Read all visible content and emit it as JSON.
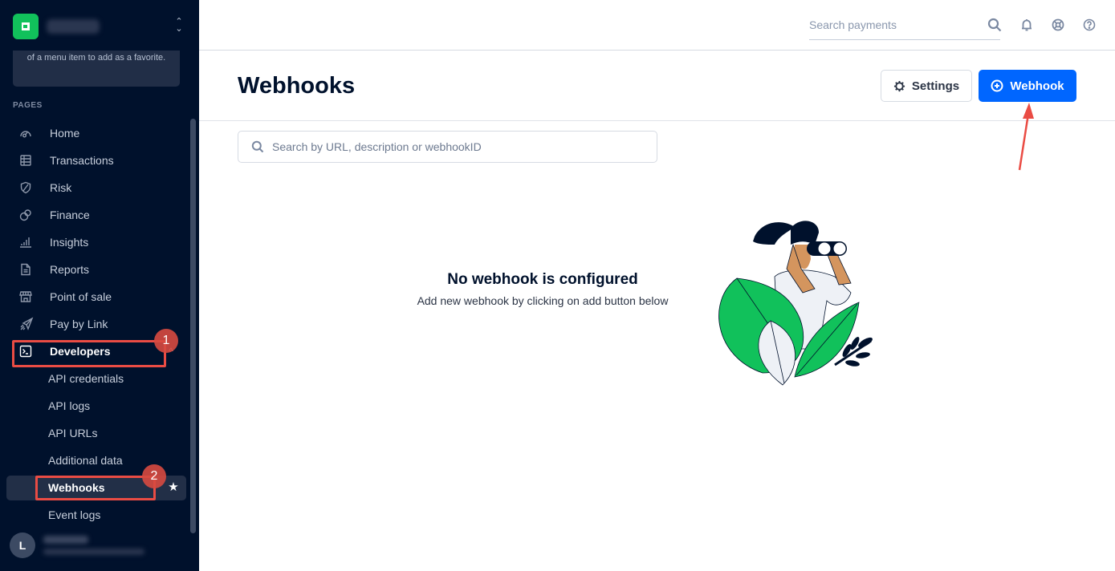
{
  "sidebar": {
    "favorite_hint": "of a menu item to add as a favorite.",
    "section_label": "PAGES",
    "nav": [
      {
        "label": "Home",
        "icon": "home-gauge-icon"
      },
      {
        "label": "Transactions",
        "icon": "table-icon"
      },
      {
        "label": "Risk",
        "icon": "shield-icon"
      },
      {
        "label": "Finance",
        "icon": "coins-icon"
      },
      {
        "label": "Insights",
        "icon": "bar-chart-icon"
      },
      {
        "label": "Reports",
        "icon": "document-icon"
      },
      {
        "label": "Point of sale",
        "icon": "store-icon"
      },
      {
        "label": "Pay by Link",
        "icon": "paper-plane-icon"
      },
      {
        "label": "Developers",
        "icon": "terminal-icon"
      }
    ],
    "developers_sub": [
      {
        "label": "API credentials"
      },
      {
        "label": "API logs"
      },
      {
        "label": "API URLs"
      },
      {
        "label": "Additional data"
      },
      {
        "label": "Webhooks"
      },
      {
        "label": "Event logs"
      }
    ],
    "active_nav": "Developers",
    "active_sub": "Webhooks",
    "avatar_initial": "L"
  },
  "annotations": {
    "step1": "1",
    "step2": "2",
    "color": "#ea4c44"
  },
  "topbar": {
    "search_placeholder": "Search payments",
    "icons": [
      "search-icon",
      "bell-icon",
      "lifebuoy-icon",
      "help-icon"
    ]
  },
  "header": {
    "title": "Webhooks",
    "settings_label": "Settings",
    "add_webhook_label": "Webhook"
  },
  "search": {
    "placeholder": "Search by URL, description or webhookID"
  },
  "empty_state": {
    "title": "No webhook is configured",
    "subtitle": "Add new webhook by clicking on add button below"
  },
  "colors": {
    "sidebar_bg": "#00112c",
    "brand_green": "#11c15b",
    "primary_blue": "#0066ff"
  }
}
